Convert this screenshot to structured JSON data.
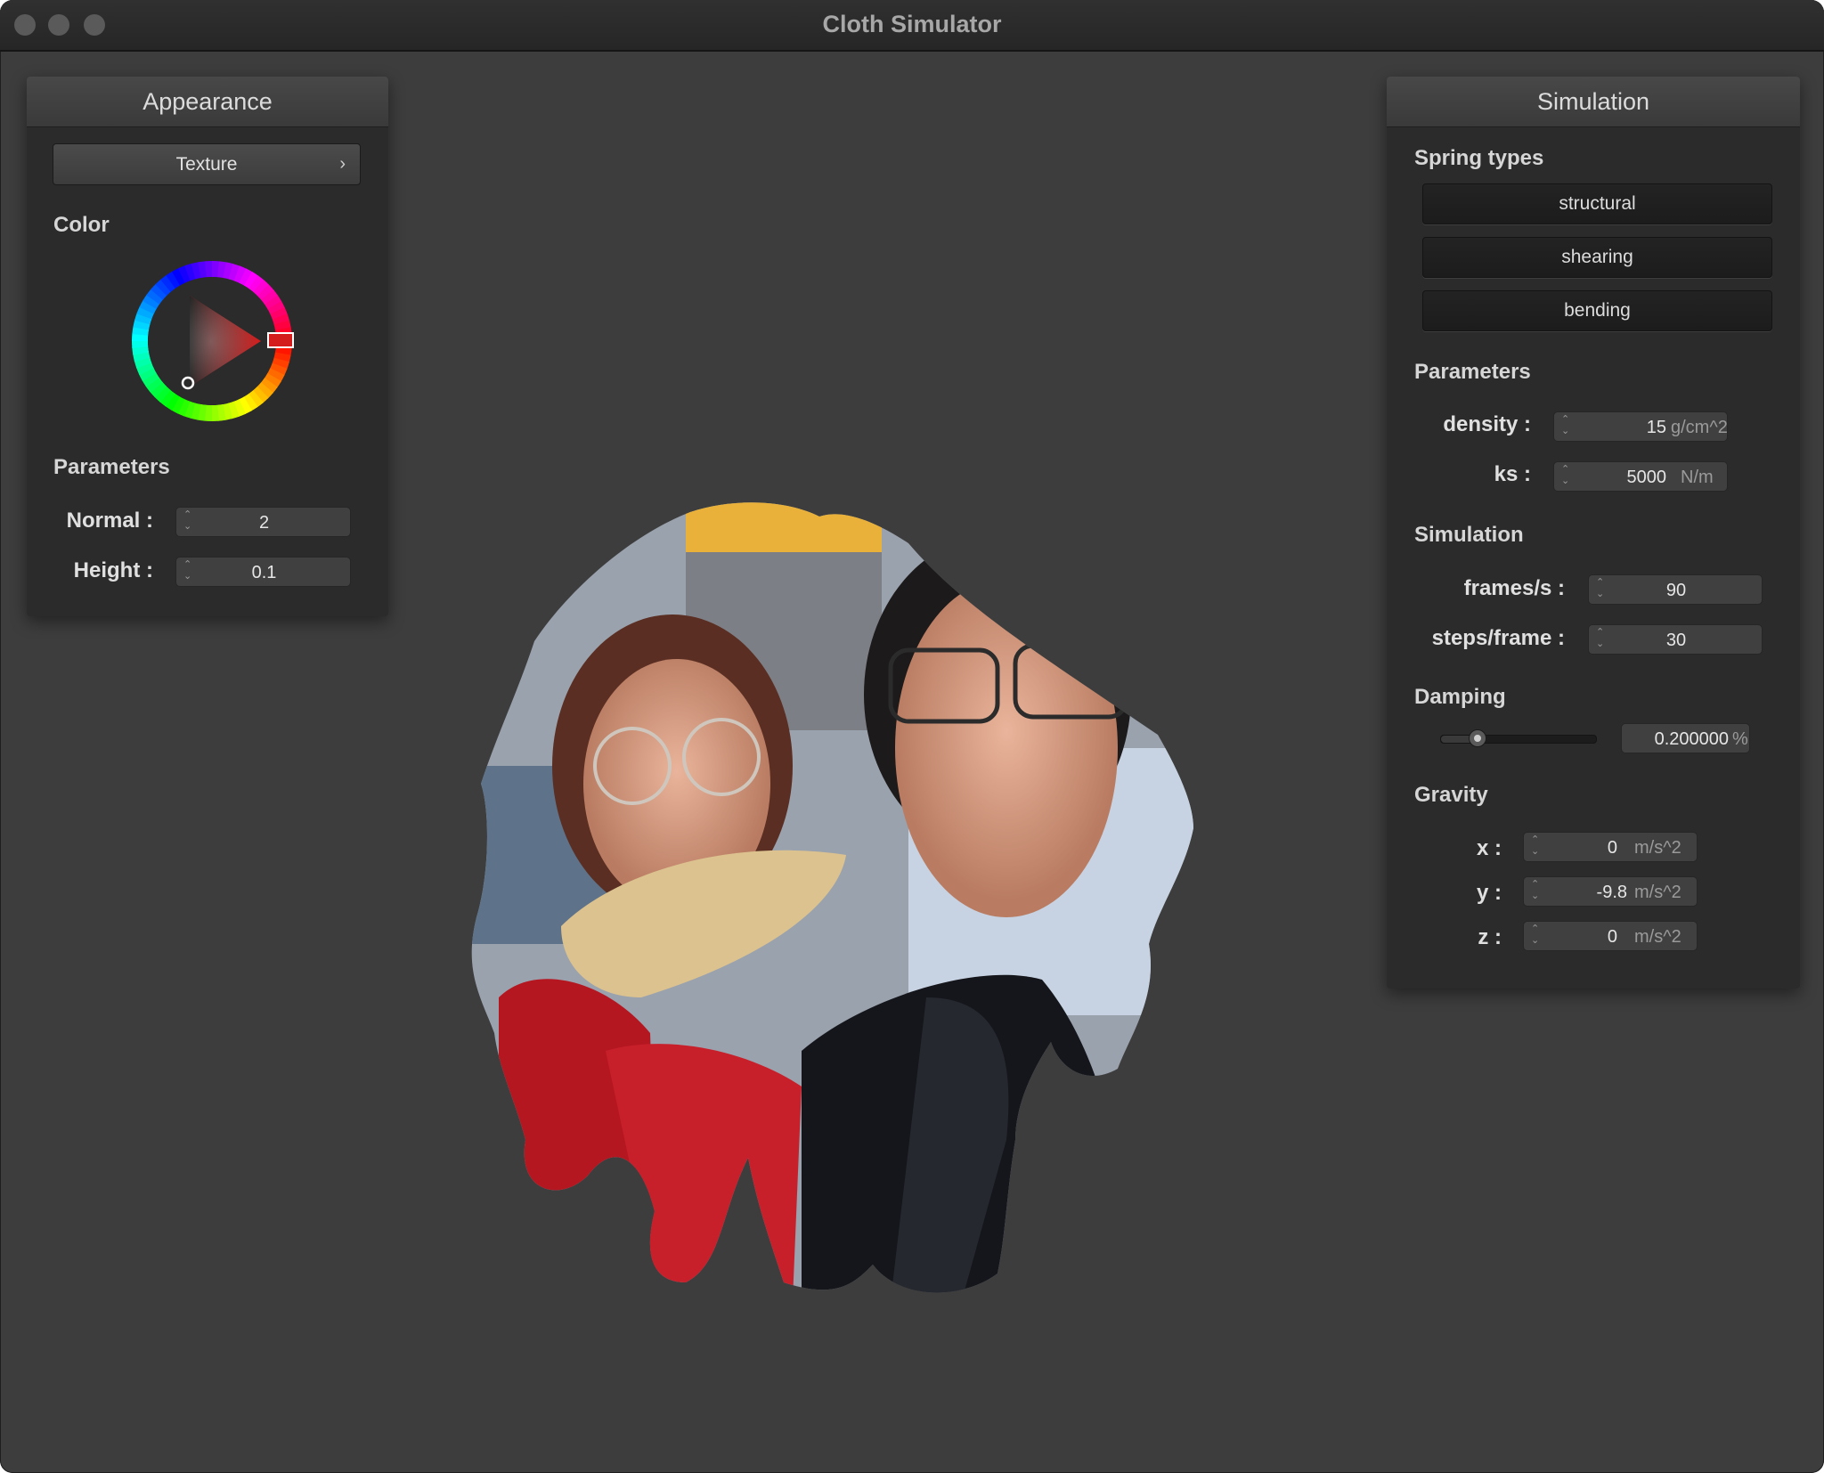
{
  "window": {
    "title": "Cloth Simulator"
  },
  "appearance": {
    "title": "Appearance",
    "texture_label": "Texture",
    "color_label": "Color",
    "color_value": "#d41c1c",
    "parameters_label": "Parameters",
    "normal": {
      "label": "Normal :",
      "value": "2"
    },
    "height": {
      "label": "Height :",
      "value": "0.1"
    }
  },
  "simulation": {
    "title": "Simulation",
    "spring_types_label": "Spring types",
    "springs": [
      "structural",
      "shearing",
      "bending"
    ],
    "parameters_label": "Parameters",
    "density": {
      "label": "density :",
      "value": "15",
      "unit": "g/cm^2"
    },
    "ks": {
      "label": "ks :",
      "value": "5000",
      "unit": "N/m"
    },
    "simulation_label": "Simulation",
    "fps": {
      "label": "frames/s :",
      "value": "90"
    },
    "steps": {
      "label": "steps/frame :",
      "value": "30"
    },
    "damping_label": "Damping",
    "damping": {
      "value": "0.200000",
      "unit": "%",
      "slider_fraction": 0.2
    },
    "gravity_label": "Gravity",
    "gx": {
      "label": "x :",
      "value": "0",
      "unit": "m/s^2"
    },
    "gy": {
      "label": "y :",
      "value": "-9.8",
      "unit": "m/s^2"
    },
    "gz": {
      "label": "z :",
      "value": "0",
      "unit": "m/s^2"
    }
  },
  "icons": [
    "close-icon",
    "minimize-icon",
    "zoom-icon",
    "chevron-right-icon",
    "spinner-icon"
  ]
}
